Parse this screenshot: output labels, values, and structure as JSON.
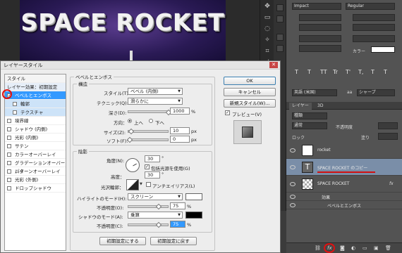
{
  "canvas": {
    "title": "SPACE ROCKET"
  },
  "character": {
    "font_family": "Impact",
    "font_style": "Regular",
    "size_fields": [
      "",
      "",
      "",
      ""
    ],
    "color_label": "カラー",
    "lang": "英語 (米国)",
    "aa": "aa",
    "aa_mode": "シャープ",
    "glyphs": [
      "T",
      "T",
      "TT",
      "Tr",
      "T'",
      "T,",
      "T",
      "T"
    ]
  },
  "layers_panel": {
    "tabs": [
      "レイヤー",
      "3D"
    ],
    "filter_label": "種類",
    "blend": "通常",
    "opacity_label": "不透明度",
    "lock_label": "ロック",
    "fill_label": "塗り",
    "layers": [
      {
        "name": "rocket",
        "type": "image"
      },
      {
        "name": "SPACE ROCKET のコピー",
        "type": "text"
      },
      {
        "name": "SPACE ROCKET",
        "type": "text",
        "fx": "fx"
      }
    ],
    "effects_label": "効果",
    "effect_item": "ベベルとエンボス",
    "fx_badge": "fx"
  },
  "dialog": {
    "title": "レイヤースタイル",
    "styles_header": "スタイル",
    "styles": [
      {
        "label": "レイヤー効果：初期設定",
        "kind": "plain"
      },
      {
        "label": "ベベルとエンボス",
        "kind": "checked-selected"
      },
      {
        "label": "輪郭",
        "kind": "sub"
      },
      {
        "label": "テクスチャ",
        "kind": "sub"
      },
      {
        "label": "境界線",
        "kind": "check"
      },
      {
        "label": "シャドウ (内側)",
        "kind": "check"
      },
      {
        "label": "光彩 (内側)",
        "kind": "check"
      },
      {
        "label": "サテン",
        "kind": "check"
      },
      {
        "label": "カラーオーバーレイ",
        "kind": "check"
      },
      {
        "label": "グラデーションオーバーレイ",
        "kind": "check"
      },
      {
        "label": "パターンオーバーレイ",
        "kind": "check"
      },
      {
        "label": "光彩 (外側)",
        "kind": "check"
      },
      {
        "label": "ドロップシャドウ",
        "kind": "check"
      }
    ],
    "section_title": "ベベルとエンボス",
    "structure": {
      "label": "構造",
      "style_label": "スタイル(T):",
      "style_value": "ベベル (内側)",
      "technique_label": "テクニック(Q):",
      "technique_value": "滑らかに",
      "depth_label": "深さ(D):",
      "depth_value": "1000",
      "depth_level_pct": 100,
      "direction_label": "方向：",
      "dir_up": "上へ",
      "dir_down": "下へ",
      "size_label": "サイズ(Z):",
      "size_value": "10",
      "size_unit": "px",
      "soften_label": "ソフト(F):",
      "soften_value": "0",
      "soften_unit": "px",
      "pct": "%"
    },
    "shading": {
      "label": "陰影",
      "angle_label": "角度(N):",
      "angle_value": "30",
      "angle_unit": "°",
      "global_light": "包括光源を使用(G)",
      "altitude_label": "高度：",
      "altitude_value": "30",
      "altitude_unit": "°",
      "gloss_label": "光沢輪郭：",
      "antialias": "アンチエイリアス(L)",
      "highlight_label": "ハイライトのモード(H):",
      "highlight_mode": "スクリーン",
      "highlight_color": "#ffffff",
      "hl_opacity_label": "不透明度(O):",
      "hl_opacity_value": "75",
      "shadow_label": "シャドウのモード(A):",
      "shadow_mode": "乗算",
      "shadow_color": "#000000",
      "sh_opacity_label": "不透明度(C):",
      "sh_opacity_value": "75",
      "pct": "%"
    },
    "buttons": {
      "make_default": "初期設定にする",
      "reset_default": "初期設定に戻す",
      "ok": "OK",
      "cancel": "キャンセル",
      "new_style": "新規スタイル(W)...",
      "preview": "プレビュー(V)"
    }
  }
}
